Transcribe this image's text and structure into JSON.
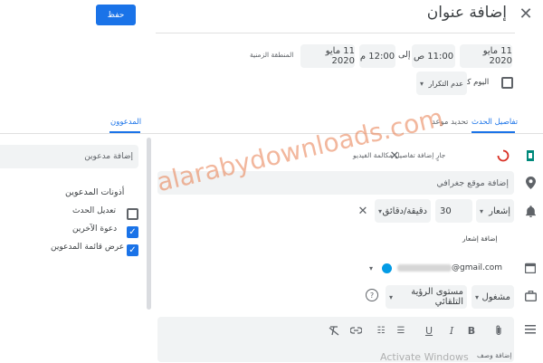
{
  "header": {
    "save_label": "حفظ",
    "title": "إضافة عنوان"
  },
  "datetime": {
    "start_date": "11 مايو 2020",
    "start_time": "11:00 ص",
    "to_label": "إلى",
    "end_time": "12:00 م",
    "end_date": "11 مايو 2020",
    "timezone_label": "المنطقة الزمنية"
  },
  "options": {
    "all_day_label": "اليوم كله",
    "repeat_label": "عدم التكرار"
  },
  "tabs": {
    "event_details": "تفاصيل الحدث",
    "find_time": "تحديد موعد",
    "guests": "المدعوون"
  },
  "details": {
    "video_text": "جارٍ إضافة تفاصيل مكالمة الفيديو",
    "location_placeholder": "إضافة موقع جغرافي",
    "notif_type": "إشعار",
    "notif_value": "30",
    "notif_unit": "دقيقة/دقائق",
    "add_notification": "إضافة إشعار",
    "calendar_email": "@gmail.com",
    "busy_label": "مشغول",
    "visibility_label": "مستوى الرؤية التلقائي",
    "description_placeholder": "إضافة وصف"
  },
  "guests": {
    "add_placeholder": "إضافة مدعوين",
    "permissions_title": "أذونات المدعوين",
    "permissions": [
      {
        "label": "تعديل الحدث",
        "checked": false
      },
      {
        "label": "دعوة الآخرين",
        "checked": true
      },
      {
        "label": "عرض قائمة المدعوين",
        "checked": true
      }
    ]
  },
  "watermark": {
    "site": "alarabydownloads.com",
    "activate": "Activate Windows"
  },
  "colors": {
    "accent": "#1a73e8",
    "field_bg": "#f1f3f4",
    "calendar_dot": "#039be5"
  }
}
